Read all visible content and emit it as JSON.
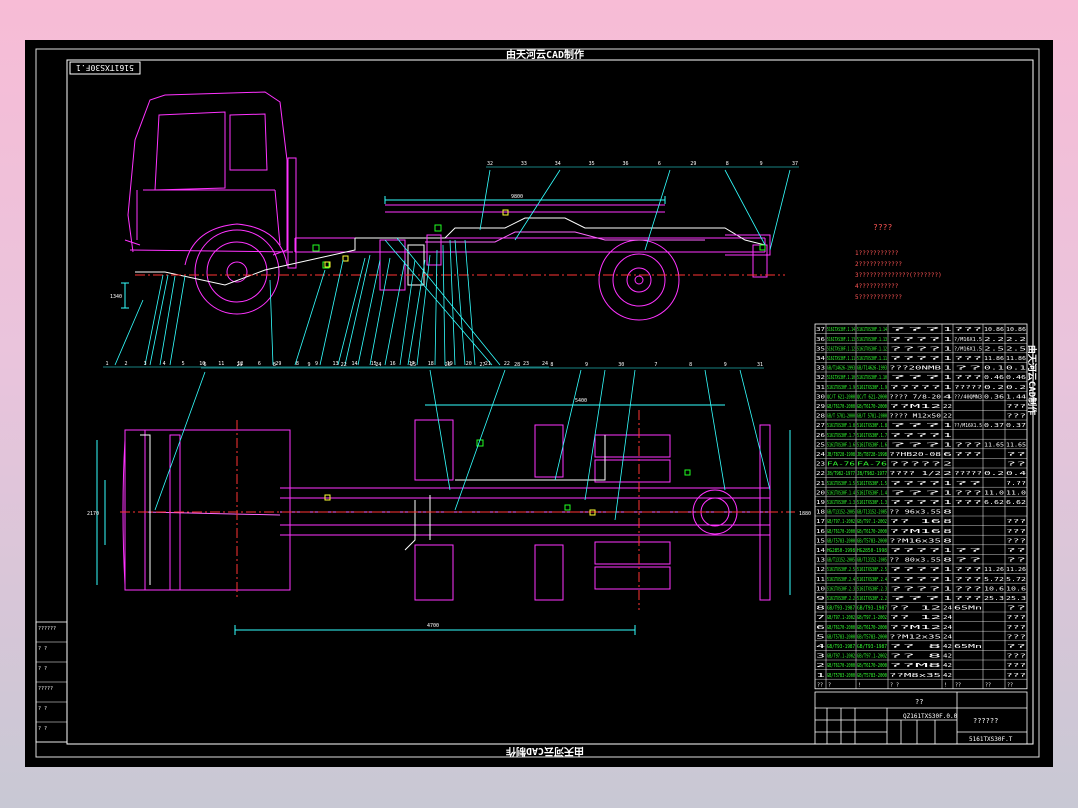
{
  "drawing": {
    "header_title": "由天河云CAD制作",
    "footer_title": "由天河云CAD制作",
    "corner_code": "5161TXS30F.1",
    "side_title": "由天河云CAD制作",
    "notes_heading": "????",
    "notes": [
      "1???????????",
      "2????????????",
      "3??????????????(???????)",
      "4???????????",
      "5????????????"
    ],
    "callouts_side": [
      "1",
      "2",
      "3",
      "4",
      "5",
      "10",
      "11",
      "12",
      "6",
      "29",
      "8",
      "9",
      "13",
      "14",
      "15",
      "16",
      "17",
      "18",
      "19",
      "20",
      "21",
      "22",
      "23",
      "24"
    ],
    "callouts_top": [
      "32",
      "33",
      "34",
      "35",
      "36",
      "6",
      "29",
      "8",
      "9",
      "37"
    ],
    "callouts_plan": [
      "6",
      "29",
      "8",
      "9",
      "22",
      "24",
      "25",
      "26",
      "27",
      "28",
      "8",
      "9",
      "30",
      "7",
      "8",
      "9",
      "31"
    ],
    "dims": [
      "9800",
      "1340",
      "4700",
      "2170",
      "1880",
      "5400"
    ],
    "left_strip": [
      "??????",
      "? ?",
      "? ?",
      "?????",
      "? ?",
      "? ?"
    ],
    "bom_rows": [
      [
        "37",
        "5161TXS30F.1.14",
        "5161TXS30F.1.14",
        "???",
        "1",
        "???",
        "10.86",
        "10.86"
      ],
      [
        "36",
        "5161TXS30F.1.13",
        "5161TXS30F.1.13",
        "????",
        "1",
        "?/M16X1.5",
        "2.2",
        "2.2"
      ],
      [
        "35",
        "5161TXS30F.1.12",
        "5161TXS30F.1.12",
        "????",
        "1",
        "?/M16X1.5",
        "2.5",
        "2.5"
      ],
      [
        "34",
        "5161TXS30F.1.11",
        "5161TXS30F.1.11",
        "????",
        "1",
        "???",
        "11.86",
        "11.86"
      ],
      [
        "33",
        "GB/T14626-1993",
        "GB/T14626-1993",
        "???20NMB",
        "1",
        "??",
        "0.1",
        "0.1"
      ],
      [
        "32",
        "5161TXS30F.1.10",
        "5161TXS30F.1.10",
        "???",
        "1",
        "???",
        "0.46",
        "0.46"
      ],
      [
        "31",
        "5161TXS30F.1.9",
        "5161TXS30F.1.9",
        "?????",
        "1",
        "?????",
        "0.2",
        "0.2"
      ],
      [
        "30",
        "QC/T 621-2000",
        "QC/T 621-2000",
        "???? 7/8-20",
        "4",
        "??/40QMN3",
        "0.36",
        "1.44"
      ],
      [
        "29",
        "GB/T6170-2000",
        "GB/T6170-2000",
        "??M12",
        "22",
        "",
        "",
        "???"
      ],
      [
        "28",
        "GB/T 5781-2000",
        "GB/T 5781-2000",
        "???? M12x50",
        "22",
        "",
        "",
        "???"
      ],
      [
        "27",
        "5161TXS30F.1.8",
        "5161TXS30F.1.8",
        "???",
        "1",
        "??/M16X1.5",
        "0.37",
        "0.37"
      ],
      [
        "26",
        "5161TXS30F.1.7",
        "5161TXS30F.1.7",
        "????",
        "1",
        "",
        "",
        ""
      ],
      [
        "25",
        "5161TXS30F.1.6",
        "5161TXS30F.1.6",
        "???",
        "1",
        "???",
        "11.65",
        "11.65"
      ],
      [
        "24",
        "JB/T8728-1998",
        "JB/T8728-1998",
        "??HB20-08",
        "6",
        "???",
        "",
        "??"
      ],
      [
        "23",
        "FA-76",
        "FA-76",
        "?????",
        "2",
        "",
        "",
        "??"
      ],
      [
        "22",
        "JB/T982-1977",
        "JB/T982-1977",
        "???? 1/2",
        "2",
        "?????",
        "0.2",
        "0.4"
      ],
      [
        "21",
        "5161TXS30F.1.5",
        "5161TXS30F.1.5",
        "????",
        "1",
        "??",
        "",
        "?.??"
      ],
      [
        "20",
        "5161TXS30F.1.4",
        "5161TXS30F.1.4",
        "???",
        "1",
        "???",
        "11.0",
        "11.0"
      ],
      [
        "19",
        "5161TXS30F.1.3",
        "5161TXS30F.1.3",
        "????",
        "1",
        "???",
        "6.62",
        "6.62"
      ],
      [
        "18",
        "GB/T13152-2005",
        "GB/T13152-2005",
        "?? 96x3.55",
        "8",
        "",
        "",
        ""
      ],
      [
        "17",
        "GB/T97.1-2002",
        "GB/T97.1-2002",
        "?? 16",
        "8",
        "",
        "",
        "???"
      ],
      [
        "16",
        "GB/T6170-2000",
        "GB/T6170-2000",
        "??M16",
        "8",
        "",
        "",
        "???"
      ],
      [
        "15",
        "GB/T5783-2000",
        "GB/T5783-2000",
        "??M16x35",
        "8",
        "",
        "",
        "???"
      ],
      [
        "14",
        "HG2850-1998",
        "HG2850-1998",
        "????",
        "1",
        "??",
        "",
        "??"
      ],
      [
        "13",
        "GB/T13152-2005",
        "GB/T13152-2005",
        "?? 80x3.55",
        "8",
        "??",
        "",
        "??"
      ],
      [
        "12",
        "5161TXS30F.2.5",
        "5161TXS30F.2.5",
        "????",
        "1",
        "???",
        "11.26",
        "11.26"
      ],
      [
        "11",
        "5161TXS30F.2.4",
        "5161TXS30F.2.4",
        "????",
        "1",
        "???",
        "5.72",
        "5.72"
      ],
      [
        "10",
        "5161TXS30F.2.3",
        "5161TXS30F.2.3",
        "????",
        "1",
        "???",
        "10.6",
        "10.6"
      ],
      [
        "9",
        "5161TXS30F.2.2",
        "5161TXS30F.2.2",
        "???",
        "1",
        "???",
        "25.3",
        "25.3"
      ],
      [
        "8",
        "GB/T93-1987",
        "GB/T93-1987",
        "?? 12",
        "24",
        "65Mn",
        "",
        "??"
      ],
      [
        "7",
        "GB/T97.1-2002",
        "GB/T97.1-2002",
        "?? 12",
        "24",
        "",
        "",
        "???"
      ],
      [
        "6",
        "GB/T6170-2000",
        "GB/T6170-2000",
        "??M12",
        "24",
        "",
        "",
        "???"
      ],
      [
        "5",
        "GB/T5783-2000",
        "GB/T5783-2000",
        "??M12x35",
        "24",
        "",
        "",
        "???"
      ],
      [
        "4",
        "GB/T93-1987",
        "GB/T93-1987",
        "?? 8",
        "42",
        "65Mn",
        "",
        "??"
      ],
      [
        "3",
        "GB/T97.1-2002",
        "GB/T97.1-2002",
        "?? 8",
        "42",
        "",
        "",
        "???"
      ],
      [
        "2",
        "GB/T6170-2000",
        "GB/T6170-2000",
        "??M8",
        "42",
        "",
        "",
        "???"
      ],
      [
        "1",
        "GB/T5783-2000",
        "GB/T5783-2000",
        "??M8x35",
        "42",
        "",
        "",
        "???"
      ]
    ],
    "bom_header": [
      "??",
      "?",
      "!",
      "? ?",
      "!",
      "??",
      "??",
      "??"
    ],
    "title_block": {
      "label": "??",
      "drawing_no": "QZ161TXS30F.0.0",
      "name": "??????",
      "code": "5161TXS30F.T"
    }
  }
}
